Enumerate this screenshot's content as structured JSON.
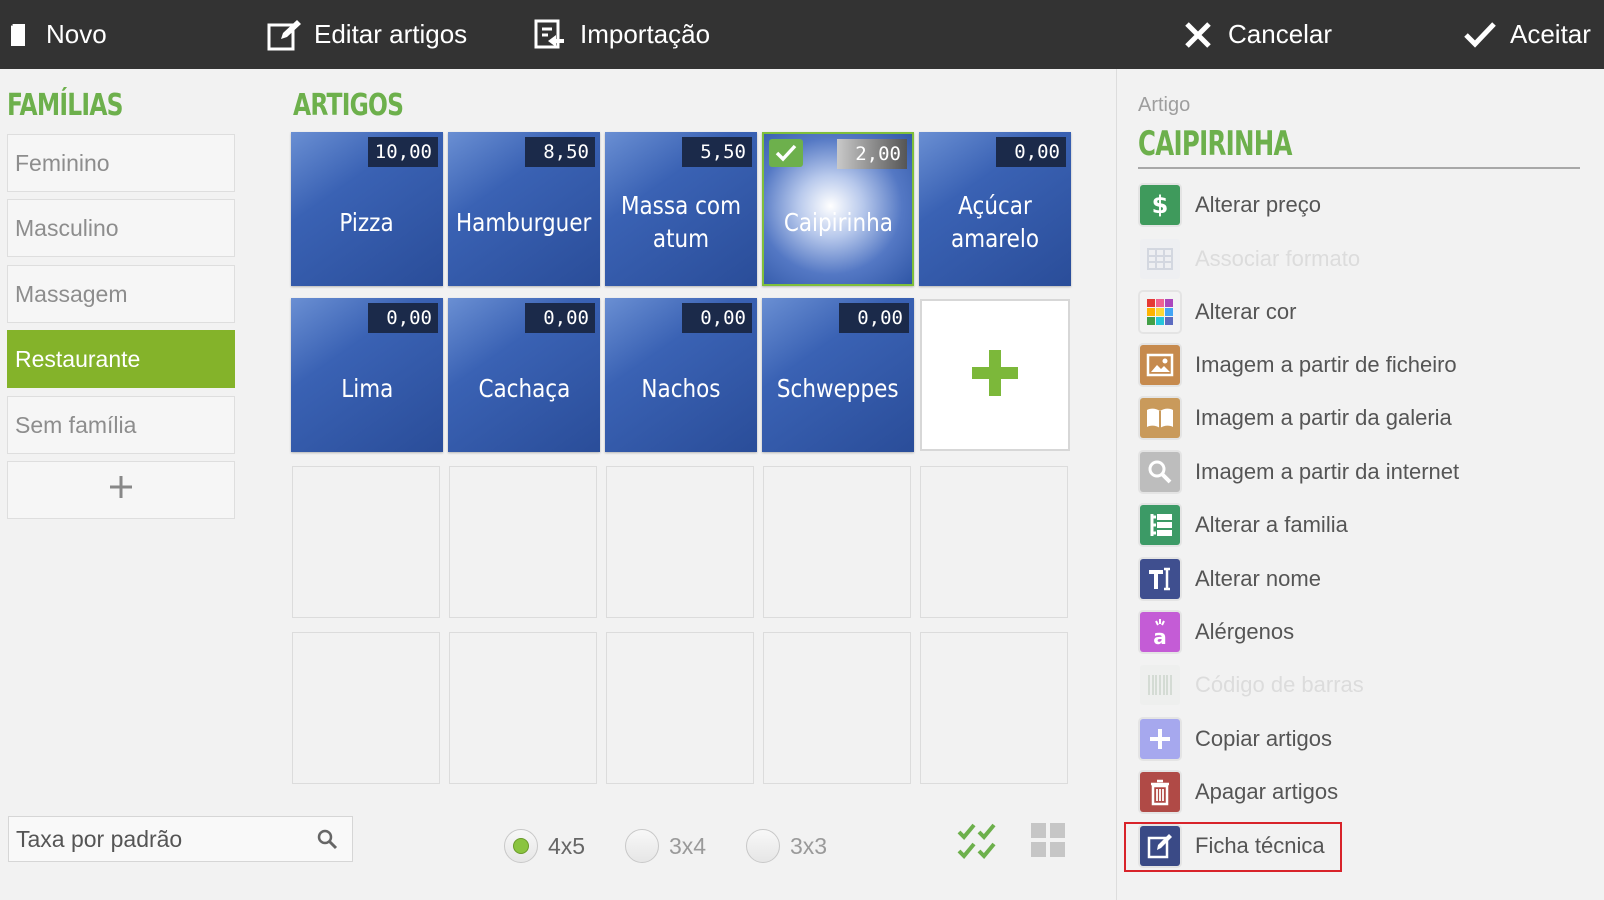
{
  "toolbar": {
    "new_label": "Novo",
    "edit_label": "Editar artigos",
    "import_label": "Importação",
    "cancel_label": "Cancelar",
    "accept_label": "Aceitar"
  },
  "families": {
    "title": "FAMÍLIAS",
    "items": [
      {
        "label": "Feminino"
      },
      {
        "label": "Masculino"
      },
      {
        "label": "Massagem"
      },
      {
        "label": "Restaurante"
      },
      {
        "label": "Sem família"
      }
    ],
    "selected": "Restaurante",
    "add_label": "+"
  },
  "articles": {
    "title": "ARTIGOS",
    "items": [
      {
        "name": "Pizza",
        "price": "10,00"
      },
      {
        "name": "Hamburguer",
        "price": "8,50"
      },
      {
        "name": "Massa com atum",
        "price": "5,50"
      },
      {
        "name": "Caipirinha",
        "price": "2,00"
      },
      {
        "name": "Açúcar amarelo",
        "price": "0,00"
      },
      {
        "name": "Lima",
        "price": "0,00"
      },
      {
        "name": "Cachaça",
        "price": "0,00"
      },
      {
        "name": "Nachos",
        "price": "0,00"
      },
      {
        "name": "Schweppes",
        "price": "0,00"
      }
    ],
    "selected": "Caipirinha"
  },
  "panel": {
    "label": "Artigo",
    "title": "CAIPIRINHA",
    "actions": [
      {
        "label": "Alterar preço",
        "icon": "dollar-icon",
        "enabled": true
      },
      {
        "label": "Associar formato",
        "icon": "grid-format-icon",
        "enabled": false
      },
      {
        "label": "Alterar cor",
        "icon": "color-palette-icon",
        "enabled": true
      },
      {
        "label": "Imagem a partir de ficheiro",
        "icon": "image-file-icon",
        "enabled": true
      },
      {
        "label": "Imagem a partir da galeria",
        "icon": "gallery-book-icon",
        "enabled": true
      },
      {
        "label": "Imagem a partir da internet",
        "icon": "magnifier-icon",
        "enabled": true
      },
      {
        "label": "Alterar a familia",
        "icon": "family-tree-icon",
        "enabled": true
      },
      {
        "label": "Alterar nome",
        "icon": "text-rename-icon",
        "enabled": true
      },
      {
        "label": "Alérgenos",
        "icon": "allergens-icon",
        "enabled": true
      },
      {
        "label": "Código de barras",
        "icon": "barcode-icon",
        "enabled": false
      },
      {
        "label": "Copiar artigos",
        "icon": "plus-copy-icon",
        "enabled": true
      },
      {
        "label": "Apagar artigos",
        "icon": "trash-icon",
        "enabled": true
      },
      {
        "label": "Ficha técnica",
        "icon": "edit-sheet-icon",
        "enabled": true
      }
    ],
    "highlighted_action": "Ficha técnica"
  },
  "bottom": {
    "search_placeholder": "Taxa por padrão",
    "layouts": [
      {
        "label": "4x5",
        "checked": true
      },
      {
        "label": "3x4",
        "checked": false
      },
      {
        "label": "3x3",
        "checked": false
      }
    ]
  },
  "colors": {
    "accent_green": "#6db04c",
    "family_active": "#84b32a",
    "tile_blue": "#2a4d99",
    "topbar": "#333333",
    "highlight_red": "#d8232a"
  }
}
